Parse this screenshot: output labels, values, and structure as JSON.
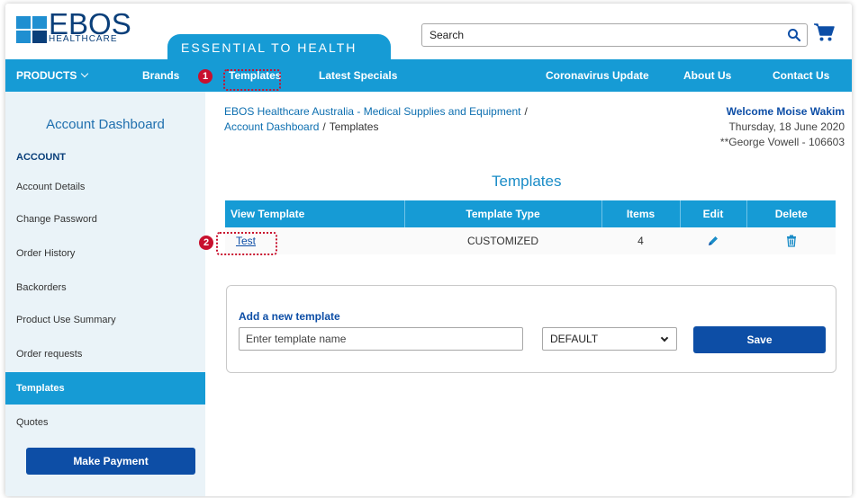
{
  "brand": {
    "logo_word": "EBOS",
    "logo_sub": "HEALTHCARE",
    "tagline": "ESSENTIAL TO HEALTH",
    "primary_color": "#169bd5",
    "navy_color": "#0d4ea6"
  },
  "search": {
    "placeholder": "Search",
    "icon": "search-icon"
  },
  "cart": {
    "icon": "cart-icon"
  },
  "nav": {
    "products": "PRODUCTS",
    "brands": "Brands",
    "templates": "Templates",
    "latest_specials": "Latest Specials",
    "coronavirus": "Coronavirus Update",
    "about": "About Us",
    "contact": "Contact Us"
  },
  "callouts": {
    "one": "1",
    "two": "2",
    "color": "#c8102e"
  },
  "sidebar": {
    "title": "Account Dashboard",
    "heading": "ACCOUNT",
    "items": [
      {
        "label": "Account Details"
      },
      {
        "label": "Change Password"
      },
      {
        "label": "Order History"
      },
      {
        "label": "Backorders"
      },
      {
        "label": "Product Use Summary"
      },
      {
        "label": "Order requests"
      },
      {
        "label": "Templates",
        "active": true
      },
      {
        "label": "Quotes"
      }
    ],
    "pay_button": "Make Payment"
  },
  "breadcrumb": {
    "root": "EBOS Healthcare Australia - Medical Supplies and Equipment",
    "sep": "/",
    "dashboard": "Account Dashboard",
    "current": "Templates"
  },
  "welcome": {
    "line1": "Welcome Moise Wakim",
    "line2": "Thursday, 18 June 2020",
    "line3": "**George Vowell - 106603"
  },
  "page_title": "Templates",
  "table": {
    "headers": [
      "View Template",
      "Template Type",
      "Items",
      "Edit",
      "Delete"
    ],
    "rows": [
      {
        "name": "Test",
        "type": "CUSTOMIZED",
        "items": "4"
      }
    ]
  },
  "add_template": {
    "label": "Add a new template",
    "placeholder": "Enter template name",
    "select_value": "DEFAULT",
    "save": "Save"
  }
}
